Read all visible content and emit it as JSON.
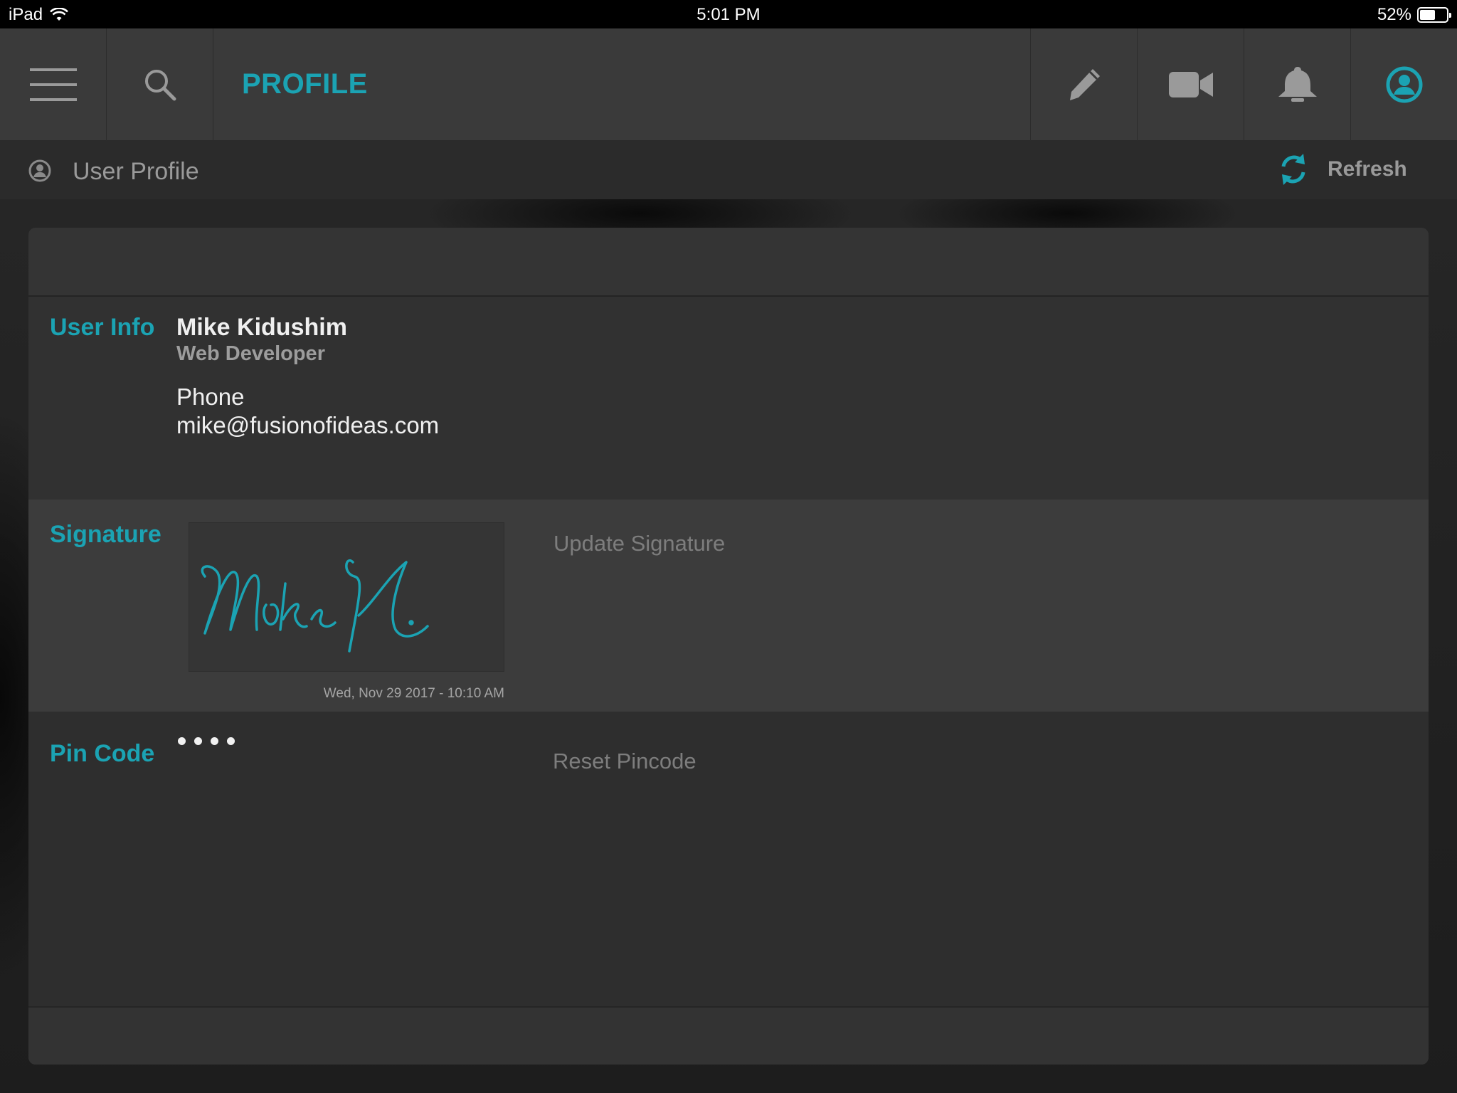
{
  "status_bar": {
    "device": "iPad",
    "time": "5:01 PM",
    "battery": "52%",
    "battery_level": 0.52
  },
  "nav": {
    "title": "PROFILE",
    "icons": [
      "menu-icon",
      "search-icon",
      "pencil-icon",
      "video-camera-icon",
      "bell-icon",
      "user-account-icon"
    ],
    "accent_color": "#1ba3b3"
  },
  "subheader": {
    "title": "User Profile",
    "refresh_label": "Refresh"
  },
  "user_info": {
    "label": "User Info",
    "name": "Mike Kidushim",
    "role": "Web Developer",
    "phone": "Phone",
    "email": "mike@fusionofideas.com"
  },
  "signature": {
    "label": "Signature",
    "date": "Wed, Nov 29 2017 - 10:10 AM",
    "update_label": "Update Signature",
    "signature_text": "Mike K."
  },
  "pin": {
    "label": "Pin Code",
    "masked_length": 4,
    "reset_label": "Reset Pincode"
  }
}
